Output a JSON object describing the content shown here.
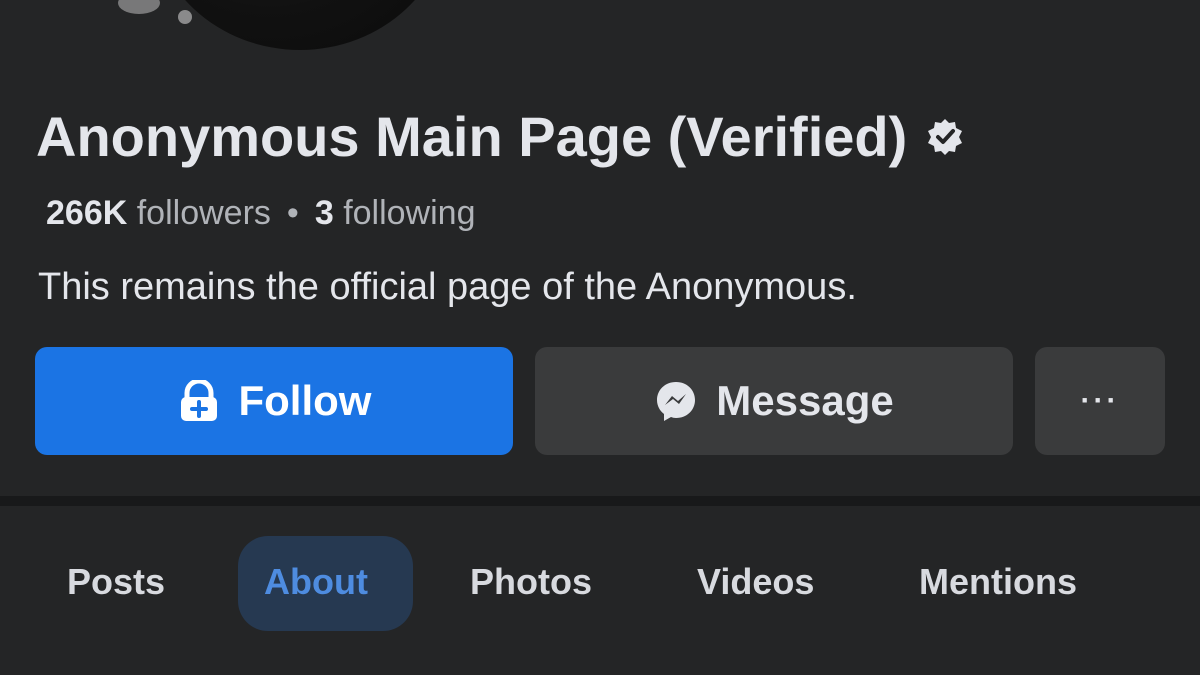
{
  "profile": {
    "title": "Anonymous Main Page (Verified)",
    "verified_icon": "verified-badge-icon",
    "followers_count": "266K",
    "followers_label": "followers",
    "separator": "•",
    "following_count": "3",
    "following_label": "following",
    "bio": "This remains the official page of the Anonymous."
  },
  "actions": {
    "follow_label": "Follow",
    "follow_icon": "follow-icon",
    "message_label": "Message",
    "message_icon": "messenger-icon",
    "more_label": "···"
  },
  "tabs": [
    {
      "label": "Posts"
    },
    {
      "label": "About",
      "active": true
    },
    {
      "label": "Photos"
    },
    {
      "label": "Videos"
    },
    {
      "label": "Mentions"
    }
  ],
  "colors": {
    "background": "#242526",
    "primary": "#1b74e4",
    "secondary_button": "#3a3b3c",
    "active_tab_text": "#4e8ce0",
    "text": "#e4e6eb"
  }
}
